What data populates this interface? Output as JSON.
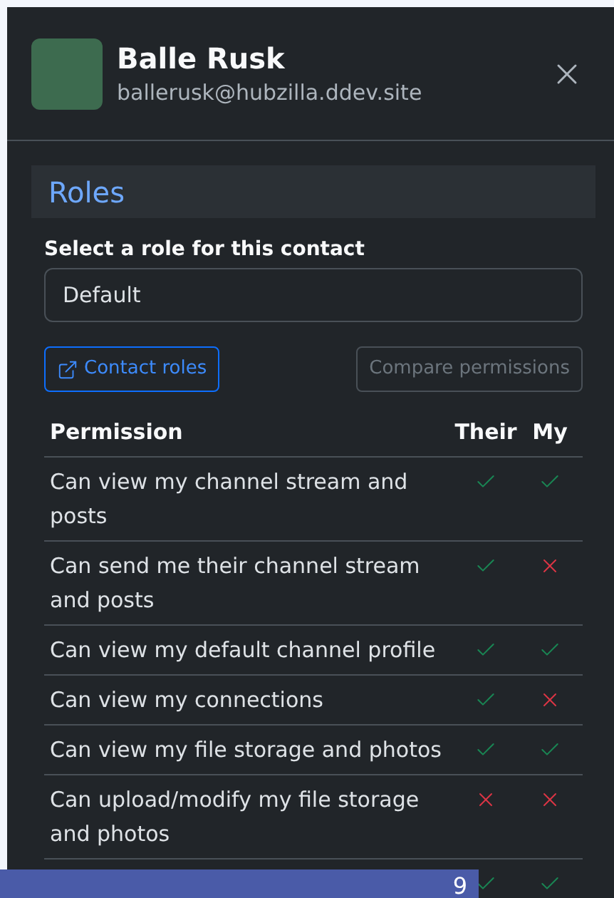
{
  "contact": {
    "name": "Balle Rusk",
    "address": "ballerusk@hubzilla.ddev.site"
  },
  "roles": {
    "title": "Roles",
    "select_label": "Select a role for this contact",
    "selected_role": "Default",
    "contact_roles_button": "Contact roles",
    "compare_button": {
      "label": "Compare permissions",
      "disabled": true
    }
  },
  "table": {
    "columns": [
      "Permission",
      "Their",
      "My"
    ],
    "rows": [
      {
        "permission": "Can view my channel stream and posts",
        "their": true,
        "my": true
      },
      {
        "permission": "Can send me their channel stream and posts",
        "their": true,
        "my": false
      },
      {
        "permission": "Can view my default channel profile",
        "their": true,
        "my": true
      },
      {
        "permission": "Can view my connections",
        "their": true,
        "my": false
      },
      {
        "permission": "Can view my file storage and photos",
        "their": true,
        "my": true
      },
      {
        "permission": "Can upload/modify my file storage and photos",
        "their": false,
        "my": false
      },
      {
        "their": true,
        "my": true
      }
    ]
  },
  "bottom_bar": {
    "count": "9"
  }
}
